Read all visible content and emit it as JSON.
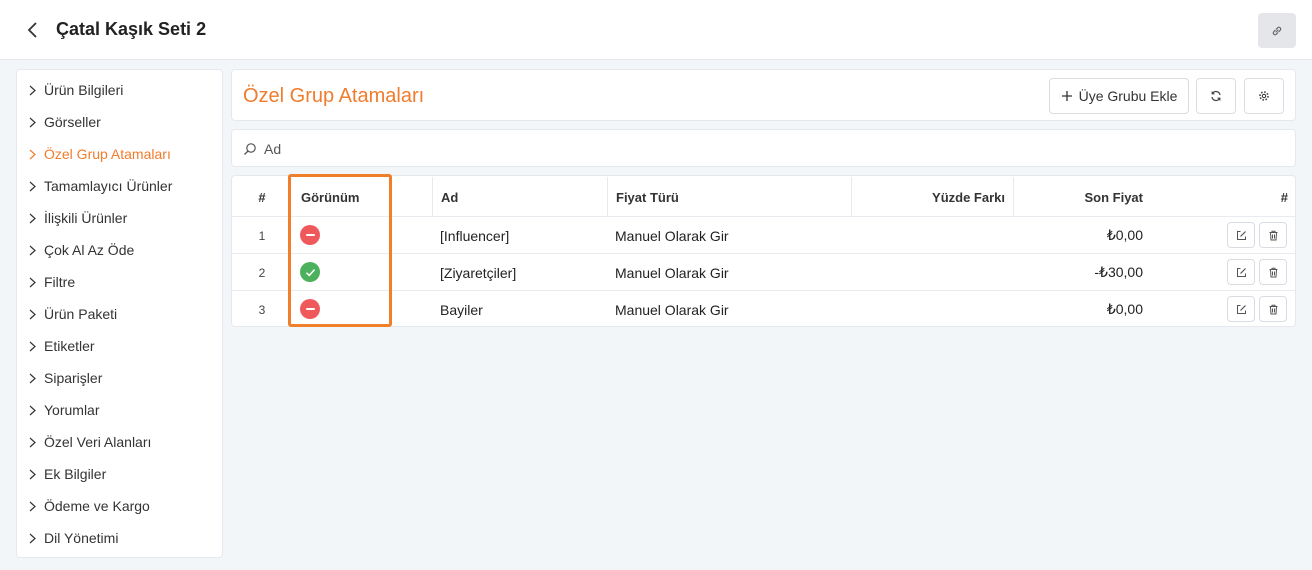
{
  "header": {
    "title": "Çatal Kaşık Seti 2",
    "back_icon": "chevron-left-icon",
    "link_icon": "link-icon"
  },
  "sidebar": {
    "active_color": "#f07c2d",
    "items": [
      {
        "label": "Ürün Bilgileri"
      },
      {
        "label": "Görseller"
      },
      {
        "label": "Özel Grup Atamaları",
        "active": true
      },
      {
        "label": "Tamamlayıcı Ürünler"
      },
      {
        "label": "İlişkili Ürünler"
      },
      {
        "label": "Çok Al Az Öde"
      },
      {
        "label": "Filtre"
      },
      {
        "label": "Ürün Paketi"
      },
      {
        "label": "Etiketler"
      },
      {
        "label": "Siparişler"
      },
      {
        "label": "Yorumlar"
      },
      {
        "label": "Özel Veri Alanları"
      },
      {
        "label": "Ek Bilgiler"
      },
      {
        "label": "Ödeme ve Kargo"
      },
      {
        "label": "Dil Yönetimi"
      }
    ]
  },
  "main": {
    "title": "Özel Grup Atamaları",
    "add_button_label": "Üye Grubu Ekle",
    "refresh_icon": "refresh-icon",
    "settings_icon": "gear-icon"
  },
  "search": {
    "placeholder": "Ad",
    "value": ""
  },
  "table": {
    "headers": {
      "index": "#",
      "visibility": "Görünüm",
      "name": "Ad",
      "price_type": "Fiyat Türü",
      "percent_diff": "Yüzde Farkı",
      "final_price": "Son Fiyat",
      "actions": "#"
    },
    "rows": [
      {
        "index": "1",
        "visible": false,
        "name": "[Influencer]",
        "price_type": "Manuel Olarak Gir",
        "percent_diff": "",
        "final_price": "₺0,00"
      },
      {
        "index": "2",
        "visible": true,
        "name": "[Ziyaretçiler]",
        "price_type": "Manuel Olarak Gir",
        "percent_diff": "",
        "final_price": "-₺30,00"
      },
      {
        "index": "3",
        "visible": false,
        "name": "Bayiler",
        "price_type": "Manuel Olarak Gir",
        "percent_diff": "",
        "final_price": "₺0,00"
      }
    ],
    "status_colors": {
      "visible": "#4cb15c",
      "hidden": "#f0595c"
    },
    "highlight_color": "#ef7f2b"
  }
}
